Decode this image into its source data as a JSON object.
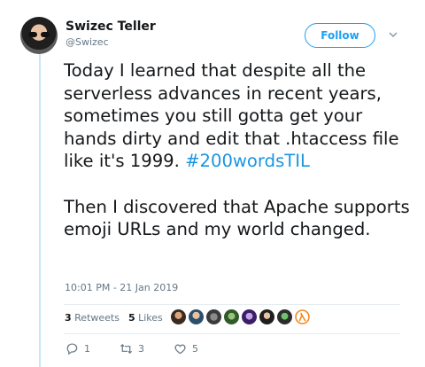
{
  "author": {
    "name": "Swizec Teller",
    "handle": "@Swizec"
  },
  "follow": {
    "label": "Follow"
  },
  "tweet": {
    "text_part1": "Today I learned that despite all the serverless advances in recent years, sometimes you still gotta get your hands dirty and edit that .htaccess file like it's 1999. ",
    "hashtag": "#200wordsTIL",
    "text_part2": "\n\nThen I discovered that Apache supports emoji URLs and my world changed."
  },
  "timestamp": "10:01 PM - 21 Jan 2019",
  "stats": {
    "retweets_count": "3",
    "retweets_label": "Retweets",
    "likes_count": "5",
    "likes_label": "Likes"
  },
  "actions": {
    "replies": "1",
    "retweets": "3",
    "likes": "5"
  },
  "colors": {
    "accent": "#1da1f2",
    "hashtag": "#1b95e0",
    "muted": "#657786",
    "thread_line": "#c8e6f8"
  },
  "likers": [
    "avatar-1",
    "avatar-2",
    "avatar-3",
    "avatar-4",
    "avatar-5",
    "avatar-6",
    "avatar-7",
    "avatar-8"
  ]
}
